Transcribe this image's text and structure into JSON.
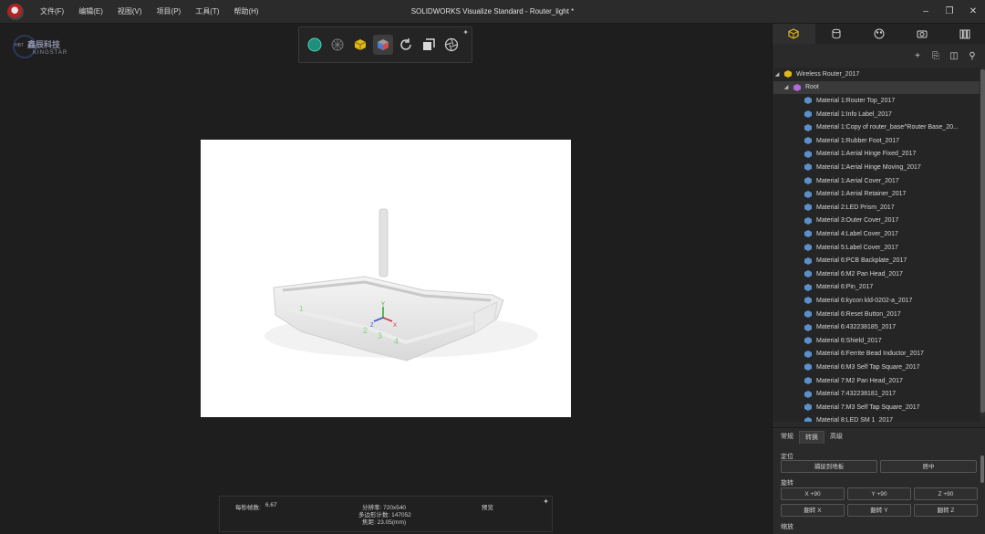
{
  "window": {
    "title": "SOLIDWORKS Visualize Standard - Router_light *",
    "menu": [
      "文件(F)",
      "编辑(E)",
      "视图(V)",
      "项目(P)",
      "工具(T)",
      "帮助(H)"
    ]
  },
  "brand": {
    "small": "HBT",
    "cn": "鑫辰科技",
    "en": "KINGSTAR"
  },
  "stats": {
    "fps_label": "每秒帧数:",
    "fps_value": "6.67",
    "resolution": "分辨率: 720x540",
    "polycount": "多边形计数: 147052",
    "focal": "焦距: 23.05(mm)",
    "mode": "预览"
  },
  "tree": {
    "root_label": "Wireless Router_2017",
    "group_label": "Root",
    "materials": [
      "Material 1:Router Top_2017",
      "Material 1:Info Label_2017",
      "Material 1:Copy of router_base^Router Base_20...",
      "Material 1:Rubber Foot_2017",
      "Material 1:Aerial Hinge Fixed_2017",
      "Material 1:Aerial Hinge Moving_2017",
      "Material 1:Aerial Cover_2017",
      "Material 1:Aerial Retainer_2017",
      "Material 2:LED Prism_2017",
      "Material 3:Outer Cover_2017",
      "Material 4:Label Cover_2017",
      "Material 5:Label Cover_2017",
      "Material 6:PCB Backplate_2017",
      "Material 6:M2 Pan Head_2017",
      "Material 6:Pin_2017",
      "Material 6:kycon kld-0202-a_2017",
      "Material 6:Reset Button_2017",
      "Material 6:432238185_2017",
      "Material 6:Shield_2017",
      "Material 6:Ferrite Bead Inductor_2017",
      "Material 6:M3 Self Tap Square_2017",
      "Material 7:M2 Pan Head_2017",
      "Material 7:432238181_2017",
      "Material 7:M3 Self Tap Square_2017",
      "Material 8:LED SM 1_2017"
    ]
  },
  "props": {
    "tabs": [
      "常规",
      "转换",
      "高级"
    ],
    "sec_position": "定位",
    "btn_snap": "捕捉到地板",
    "btn_center": "居中",
    "sec_rotate": "旋转",
    "btn_x90": "X +90",
    "btn_y90": "Y +90",
    "btn_z90": "Z +90",
    "btn_flipx": "翻转 X",
    "btn_flipy": "翻转 Y",
    "btn_flipz": "翻转 Z",
    "sec_scale": "缩放"
  },
  "colors": {
    "cube": "#5a8fc9",
    "root_cube": "#b26bd6",
    "top_cube": "#e8c21a"
  }
}
